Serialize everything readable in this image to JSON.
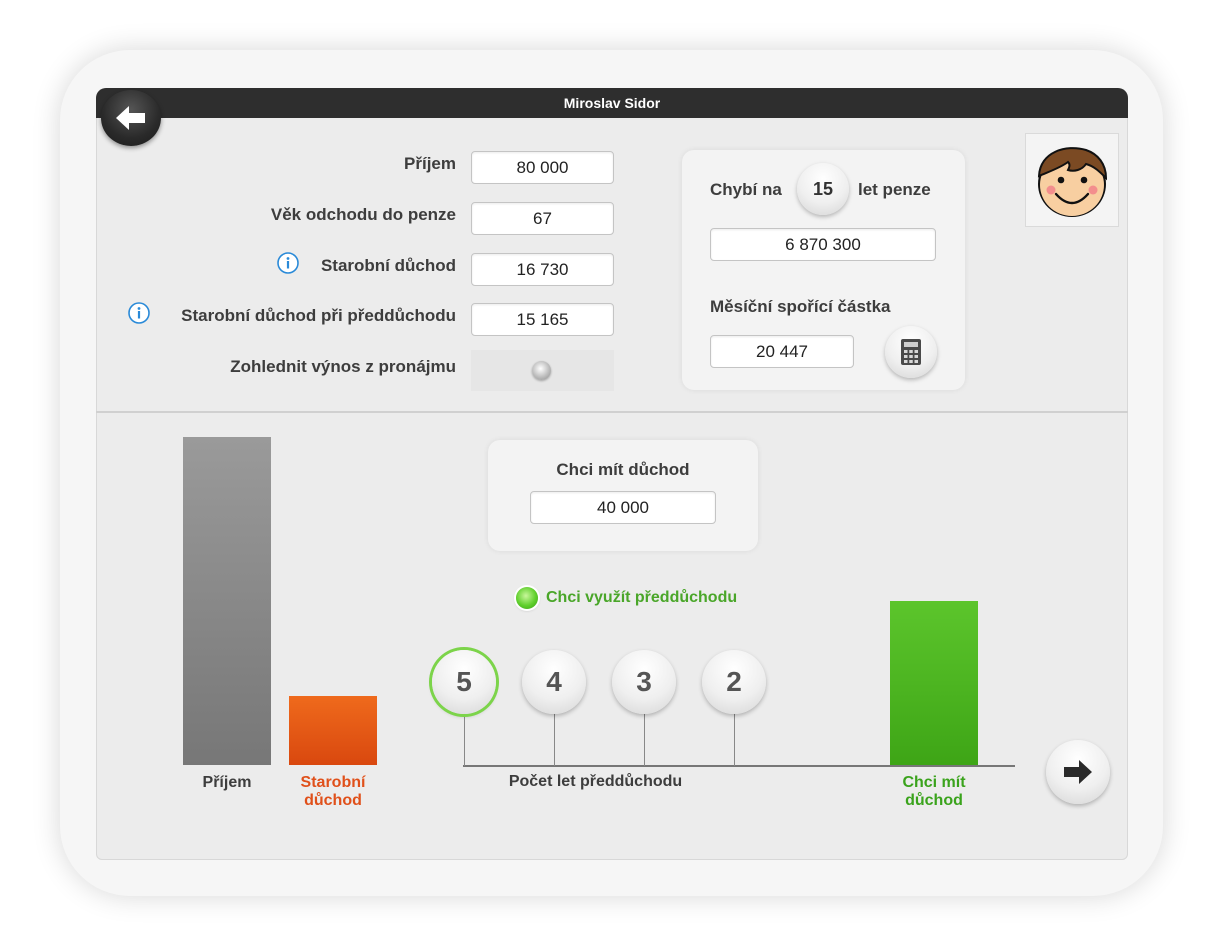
{
  "header": {
    "title": "Miroslav Sidor"
  },
  "inputs": {
    "income_label": "Příjem",
    "income_value": "80 000",
    "retirement_age_label": "Věk odchodu do penze",
    "retirement_age_value": "67",
    "pension_label": "Starobní důchod",
    "pension_value": "16 730",
    "early_pension_label": "Starobní důchod při předdůchodu",
    "early_pension_value": "15 165",
    "rental_label": "Zohlednit výnos z pronájmu"
  },
  "summary": {
    "missing_prefix": "Chybí na",
    "missing_years": "15",
    "missing_suffix": "let penze",
    "missing_amount": "6 870 300",
    "monthly_label": "Měsíční spořící částka",
    "monthly_value": "20 447"
  },
  "desired": {
    "label": "Chci mít důchod",
    "value": "40 000"
  },
  "early_toggle": {
    "label": "Chci využít předdůchodu",
    "checked": true
  },
  "early_years": {
    "options": [
      "5",
      "4",
      "3",
      "2"
    ],
    "selected": "5",
    "axis_label": "Počet let předdůchodu"
  },
  "chart_data": {
    "type": "bar",
    "categories": [
      "Příjem",
      "Starobní důchod",
      "Chci mít důchod"
    ],
    "values": [
      80000,
      16730,
      40000
    ],
    "colors": [
      "#8a8a8a",
      "#e45a16",
      "#4fb520"
    ],
    "label_colors": [
      "#3d3d3d",
      "#e0501a",
      "#3aa31c"
    ],
    "ylim": [
      0,
      80000
    ]
  },
  "icons": {
    "back": "arrow-left-icon",
    "next": "arrow-right-icon",
    "calculator": "calculator-icon",
    "info": "info-icon",
    "avatar": "boy-face-avatar"
  }
}
